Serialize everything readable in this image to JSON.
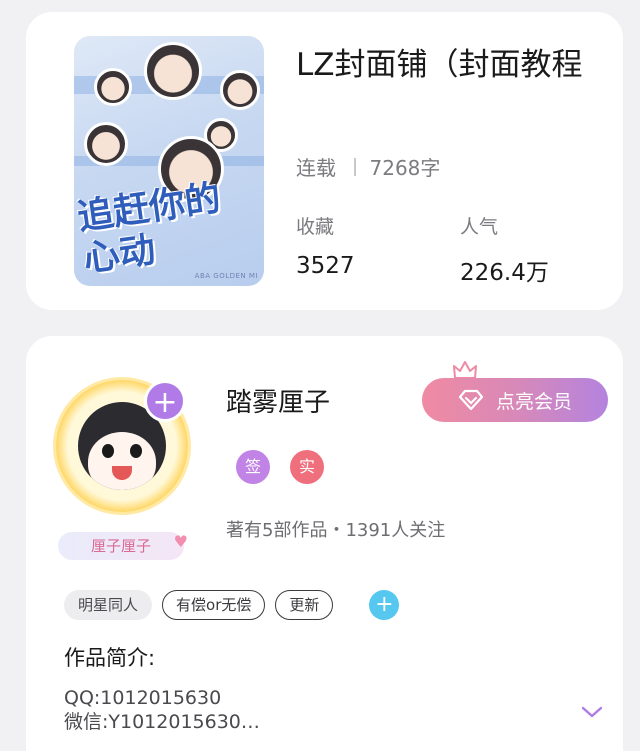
{
  "book": {
    "cover_title": "追赶你的心动",
    "cover_tag": "ABA GOLDEN MI",
    "title": "LZ封面铺（封面教程",
    "status": "连载",
    "word_count": "7268字",
    "favorites_label": "收藏",
    "favorites_value": "3527",
    "popularity_label": "人气",
    "popularity_value": "226.4万"
  },
  "author": {
    "name": "踏雾厘子",
    "nickname_tag": "厘子厘子",
    "follow_icon": "plus-icon",
    "vip_button": "点亮会员",
    "badge_signed": "签",
    "badge_verified": "实",
    "stats": "著有5部作品・1391人关注"
  },
  "tags": {
    "items": [
      "明星同人",
      "有偿or无偿",
      "更新"
    ],
    "add_icon": "plus-icon"
  },
  "intro": {
    "title": "作品简介:",
    "line1": "QQ:1012015630",
    "line2": "微信:Y1012015630…"
  },
  "colors": {
    "vip_gradient_start": "#f08aa2",
    "vip_gradient_end": "#b483df",
    "signed_badge": "#c183e6",
    "verified_badge": "#ef6f7d",
    "add_tag": "#56c8f0",
    "expand_chevron": "#b07be6"
  }
}
